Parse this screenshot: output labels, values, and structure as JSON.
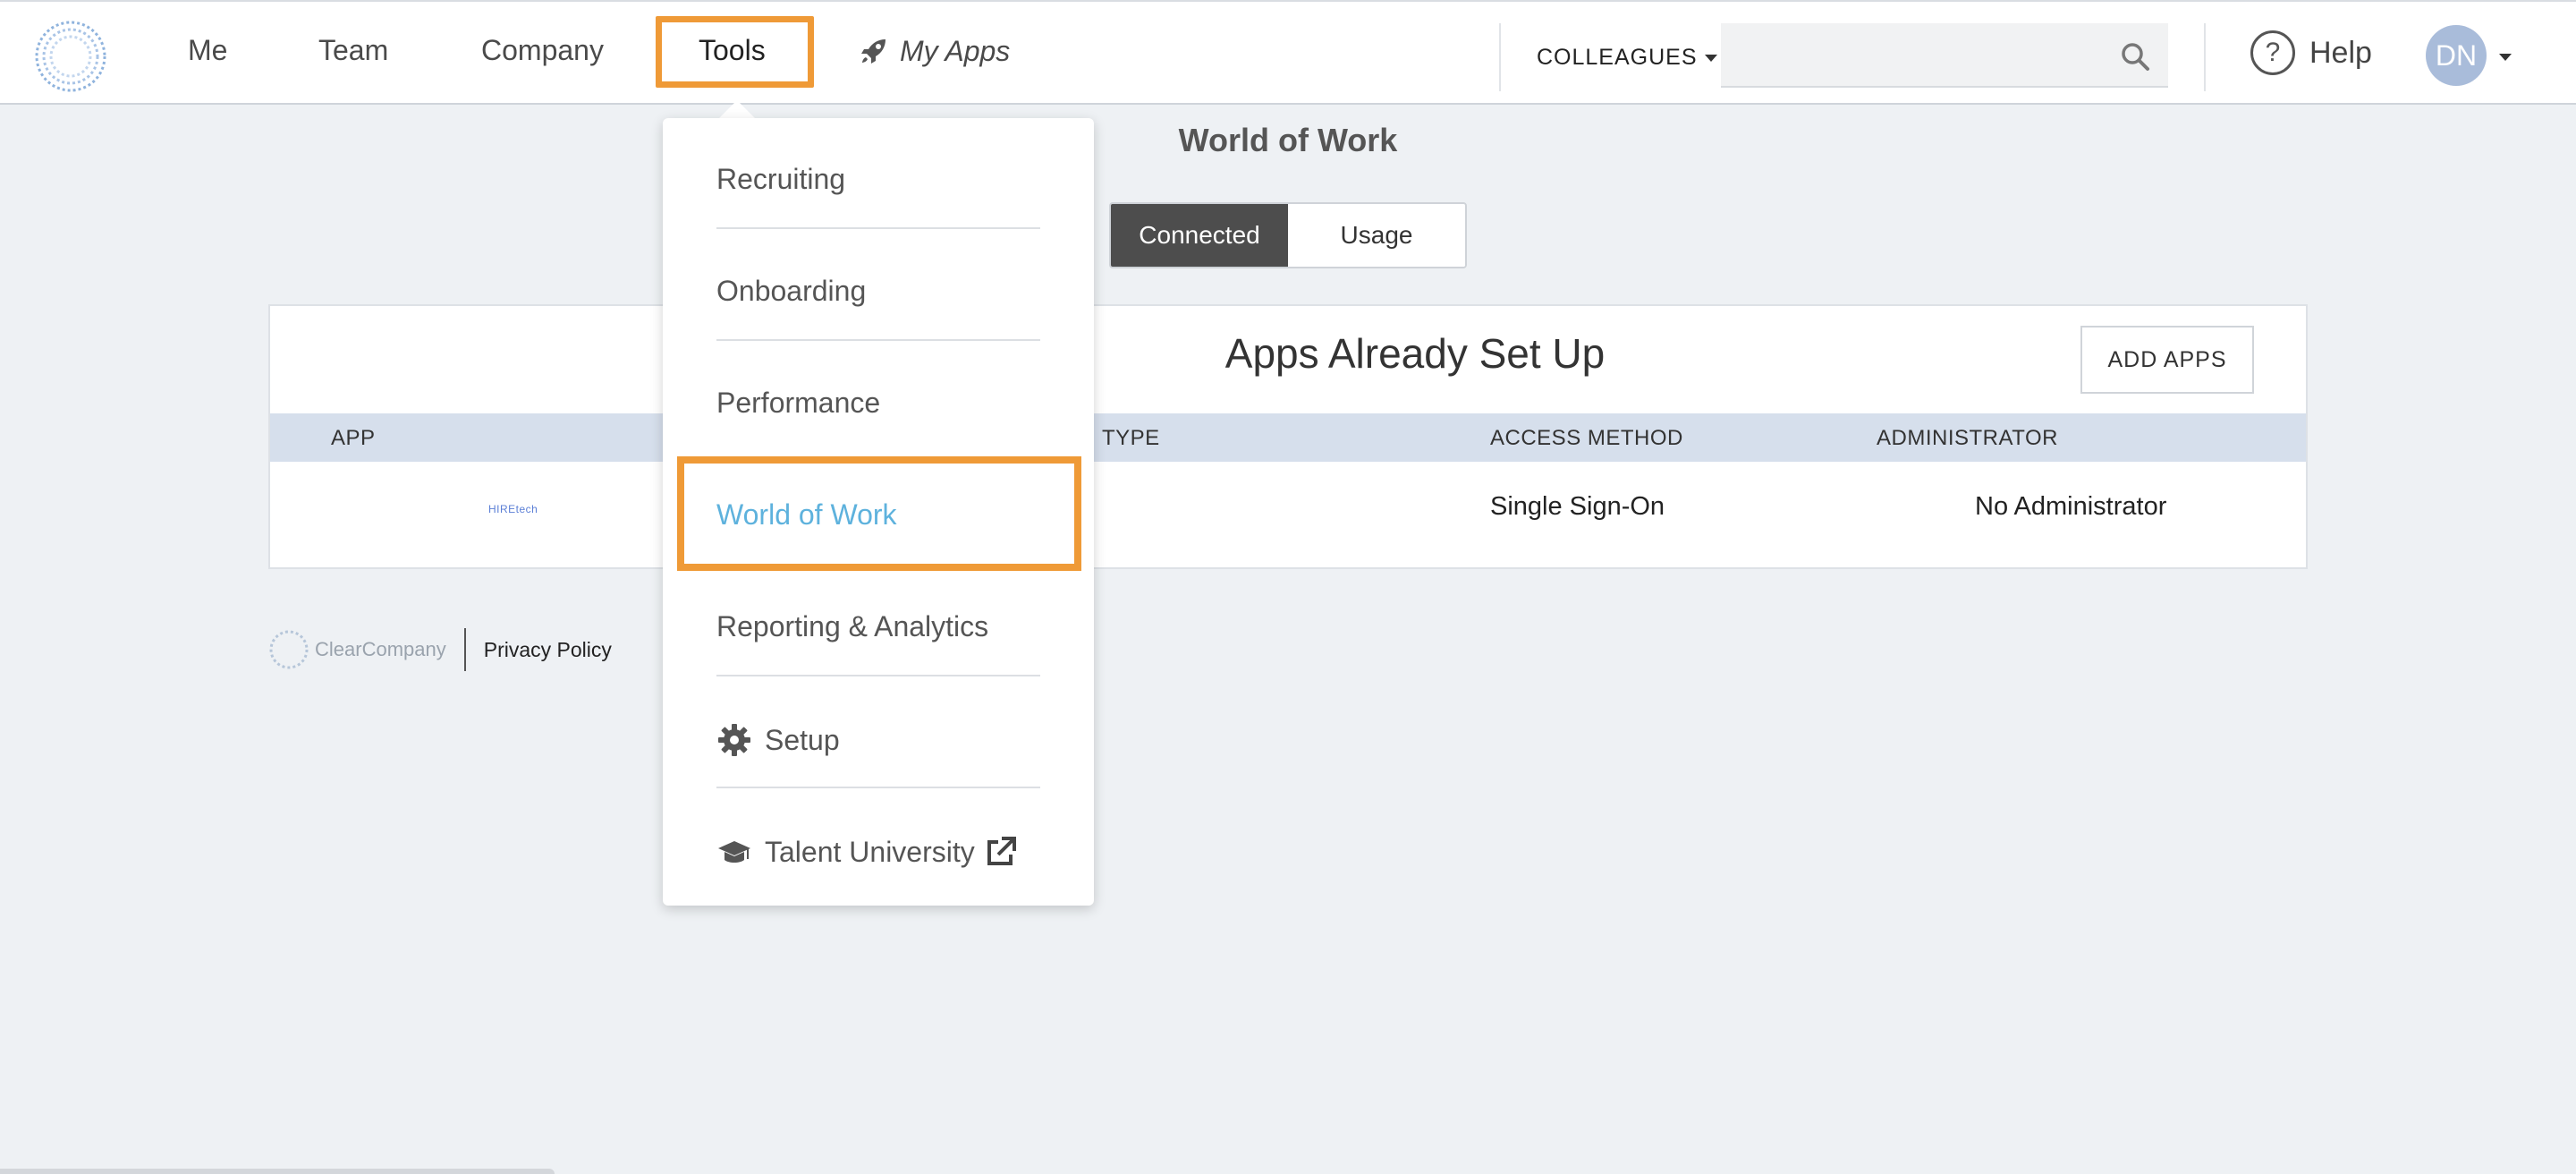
{
  "nav": {
    "items": [
      {
        "label": "Me"
      },
      {
        "label": "Team"
      },
      {
        "label": "Company"
      },
      {
        "label": "Tools"
      }
    ],
    "my_apps_label": "My Apps",
    "colleagues_label": "COLLEAGUES",
    "search": {
      "placeholder": "",
      "value": ""
    },
    "help_label": "Help",
    "help_glyph": "?",
    "avatar_initials": "DN"
  },
  "main": {
    "page_title": "World of Work",
    "segments": [
      {
        "label": "Connected",
        "active": true
      },
      {
        "label": "Usage",
        "active": false
      }
    ],
    "panel_title": "Apps Already Set Up",
    "add_apps_label": "ADD APPS",
    "table": {
      "headers": [
        "APP",
        "TYPE",
        "ACCESS METHOD",
        "ADMINISTRATOR"
      ],
      "rows": [
        {
          "app_logo_text": "HIREtech",
          "type": "",
          "access_method": "Single Sign-On",
          "administrator": "No Administrator"
        }
      ]
    }
  },
  "footer": {
    "brand": "ClearCompany",
    "privacy_label": "Privacy Policy"
  },
  "tools_menu": {
    "items": [
      {
        "label": "Recruiting"
      },
      {
        "label": "Onboarding"
      },
      {
        "label": "Performance"
      },
      {
        "label": "World of Work",
        "highlighted": true
      },
      {
        "label": "Reporting & Analytics"
      },
      {
        "label": "Setup",
        "icon": "gear-icon"
      },
      {
        "label": "Talent University",
        "icon": "graduation-cap-icon",
        "trailing_icon": "external-link-icon"
      }
    ]
  },
  "colors": {
    "highlight_outline": "#ef9a37",
    "link_blue": "#5eb2dd",
    "active_segment": "#4d4d4d",
    "table_header_bg": "#d6dfec",
    "avatar_bg": "#a9bcda"
  }
}
